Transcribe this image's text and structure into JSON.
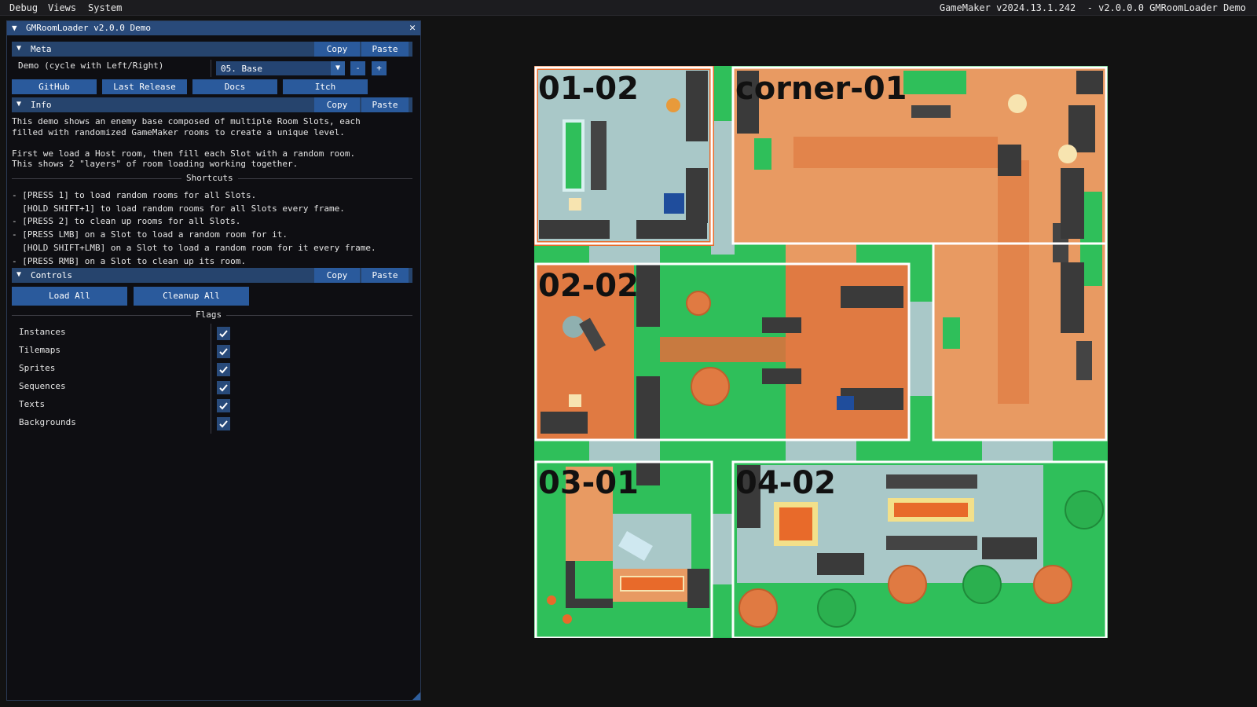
{
  "menubar": {
    "items": [
      "Debug",
      "Views",
      "System"
    ],
    "right_text": "GameMaker v2024.13.1.242  - v2.0.0.0 GMRoomLoader Demo"
  },
  "panel": {
    "title": "GMRoomLoader v2.0.0 Demo",
    "close_glyph": "✕",
    "collapse_glyph": "▼",
    "meta": {
      "header": "Meta",
      "copy": "Copy",
      "paste": "Paste",
      "demo_label": "Demo (cycle with Left/Right)",
      "demo_value": "05. Base",
      "minus": "-",
      "plus": "+",
      "links": [
        "GitHub",
        "Last Release",
        "Docs",
        "Itch"
      ]
    },
    "info": {
      "header": "Info",
      "copy": "Copy",
      "paste": "Paste",
      "text": "This demo shows an enemy base composed of multiple Room Slots, each\nfilled with randomized GameMaker rooms to create a unique level.\n\nFirst we load a Host room, then fill each Slot with a random room.\nThis shows 2 \"layers\" of room loading working together.",
      "shortcuts_title": "Shortcuts",
      "shortcuts": "- [PRESS 1] to load random rooms for all Slots.\n  [HOLD SHIFT+1] to load random rooms for all Slots every frame.\n- [PRESS 2] to clean up rooms for all Slots.\n- [PRESS LMB] on a Slot to load a random room for it.\n  [HOLD SHIFT+LMB] on a Slot to load a random room for it every frame.\n- [PRESS RMB] on a Slot to clean up its room."
    },
    "controls": {
      "header": "Controls",
      "copy": "Copy",
      "paste": "Paste",
      "load_all": "Load All",
      "cleanup_all": "Cleanup All",
      "flags_title": "Flags",
      "flags": [
        {
          "label": "Instances",
          "checked": true
        },
        {
          "label": "Tilemaps",
          "checked": true
        },
        {
          "label": "Sprites",
          "checked": true
        },
        {
          "label": "Sequences",
          "checked": true
        },
        {
          "label": "Texts",
          "checked": true
        },
        {
          "label": "Backgrounds",
          "checked": true
        }
      ]
    }
  },
  "map": {
    "rooms": [
      "01-02",
      "corner-01",
      "02-02",
      "03-01",
      "04-02"
    ]
  },
  "colors": {
    "accent": "#2a5a9c",
    "grass": "#2fbf5a",
    "wood_floor": "#e89a62",
    "tile_floor": "#a9c8c8",
    "wall": "#3a3a3a",
    "slot_border": "#ffffff"
  }
}
